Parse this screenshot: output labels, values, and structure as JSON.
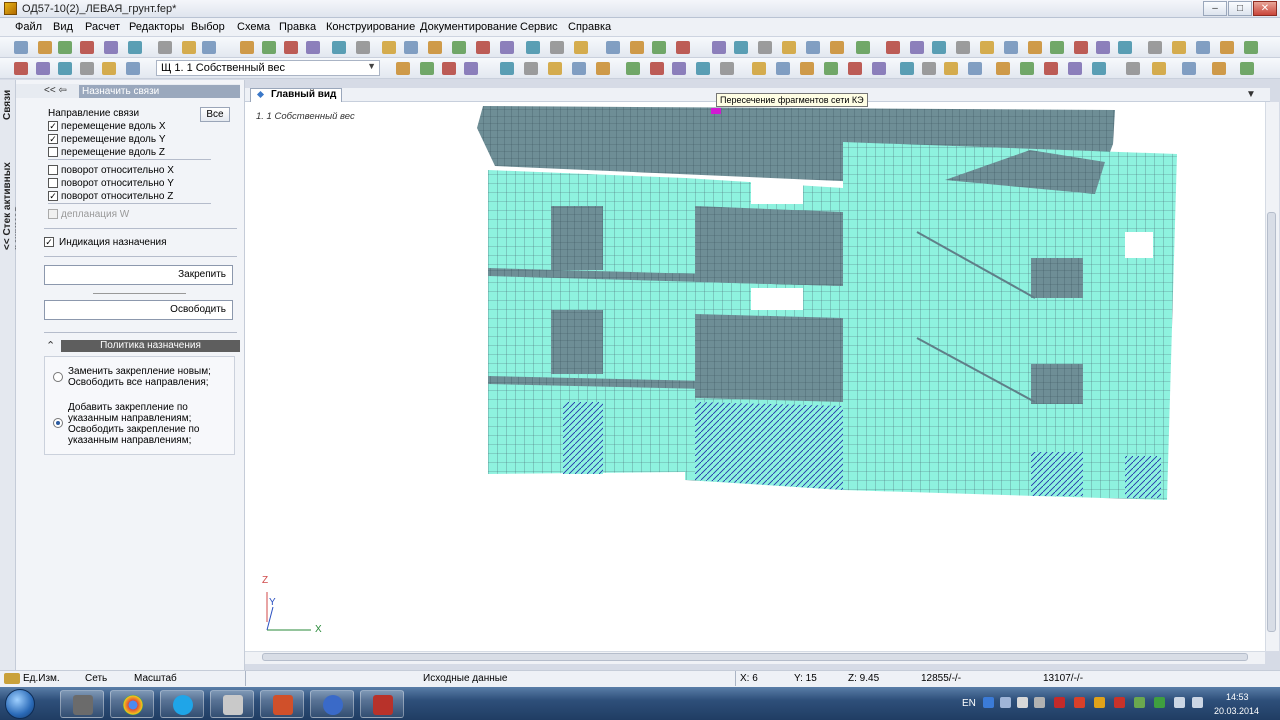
{
  "window": {
    "title": "ОД57-10(2)_ЛЕВАЯ_грунт.fep*",
    "minimize": "–",
    "maximize": "□",
    "close": "✕"
  },
  "menu": [
    "Файл",
    "Вид",
    "Расчет",
    "Редакторы",
    "Выбор",
    "Схема",
    "Правка",
    "Конструирование",
    "Документирование",
    "Сервис",
    "Справка"
  ],
  "toolbar": {
    "load_case": "1. 1 Собственный вес",
    "load_case_prefix": "Щ"
  },
  "left_strip": {
    "label_links": "Связи",
    "label_stack": "<< Стек активных режимов"
  },
  "panel": {
    "nav": "<<   ⇦",
    "title": "Назначить связи",
    "direction_label": "Направление связи",
    "all_button": "Все",
    "options": [
      {
        "label": "перемещение вдоль X",
        "checked": true,
        "enabled": true
      },
      {
        "label": "перемещение вдоль Y",
        "checked": true,
        "enabled": true
      },
      {
        "label": "перемещение вдоль Z",
        "checked": false,
        "enabled": true
      },
      {
        "label": "поворот относительно X",
        "checked": false,
        "enabled": true
      },
      {
        "label": "поворот относительно Y",
        "checked": false,
        "enabled": true
      },
      {
        "label": "поворот относительно Z",
        "checked": true,
        "enabled": true
      },
      {
        "label": "депланация W",
        "checked": false,
        "enabled": false
      }
    ],
    "indication": {
      "label": "Индикация назначения",
      "checked": true
    },
    "fix_button": "Закрепить",
    "release_button": "Освободить",
    "policy_title": "Политика назначения",
    "policy_options": [
      {
        "label": "Заменить закрепление новым;\nОсвободить все направления;",
        "selected": false
      },
      {
        "label": "Добавить закрепление по указанным направлениям;\nОсвободить закрепление по указанным направлениям;",
        "selected": true
      }
    ]
  },
  "view": {
    "tab": "Главный вид",
    "load_label": "1. 1 Собственный вес",
    "tooltip": "Пересечение фрагментов сети КЭ",
    "axis_z": "Z",
    "axis_y": "Y",
    "axis_x": "X"
  },
  "status": {
    "units": "Ед.Изм.",
    "grid": "Сеть",
    "scale": "Масштаб",
    "mode": "Исходные данные",
    "x": "X:  6",
    "y": "Y:  15",
    "z": "Z:  9.45",
    "nodes": "12855/-/-",
    "elements": "13107/-/-"
  },
  "taskbar": {
    "lang": "EN",
    "time": "14:53",
    "date": "20.03.2014"
  },
  "colors": {
    "mesh_fill": "#8ef2df",
    "mesh_line": "#4b6a74",
    "roof": "#6a8a93",
    "highlight": "#d21ad2"
  }
}
